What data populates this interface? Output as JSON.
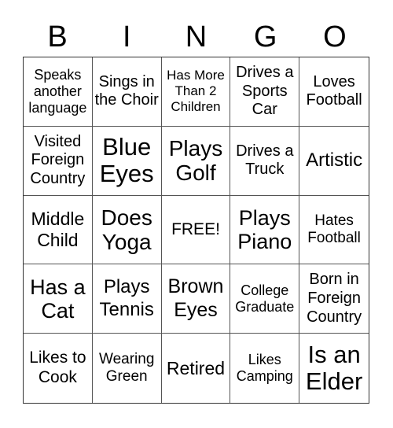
{
  "header": {
    "letters": [
      "B",
      "I",
      "N",
      "G",
      "O"
    ]
  },
  "cells": [
    "Speaks another language",
    "Sings in the Choir",
    "Has More Than 2 Children",
    "Drives a Sports Car",
    "Loves Football",
    "Visited Foreign Country",
    "Blue Eyes",
    "Plays Golf",
    "Drives a Truck",
    "Artistic",
    "Middle Child",
    "Does Yoga",
    "FREE!",
    "Plays Piano",
    "Hates Football",
    "Has a Cat",
    "Plays Tennis",
    "Brown Eyes",
    "College Graduate",
    "Born in Foreign Country",
    "Likes to Cook",
    "Wearing Green",
    "Retired",
    "Likes Camping",
    "Is an Elder"
  ]
}
